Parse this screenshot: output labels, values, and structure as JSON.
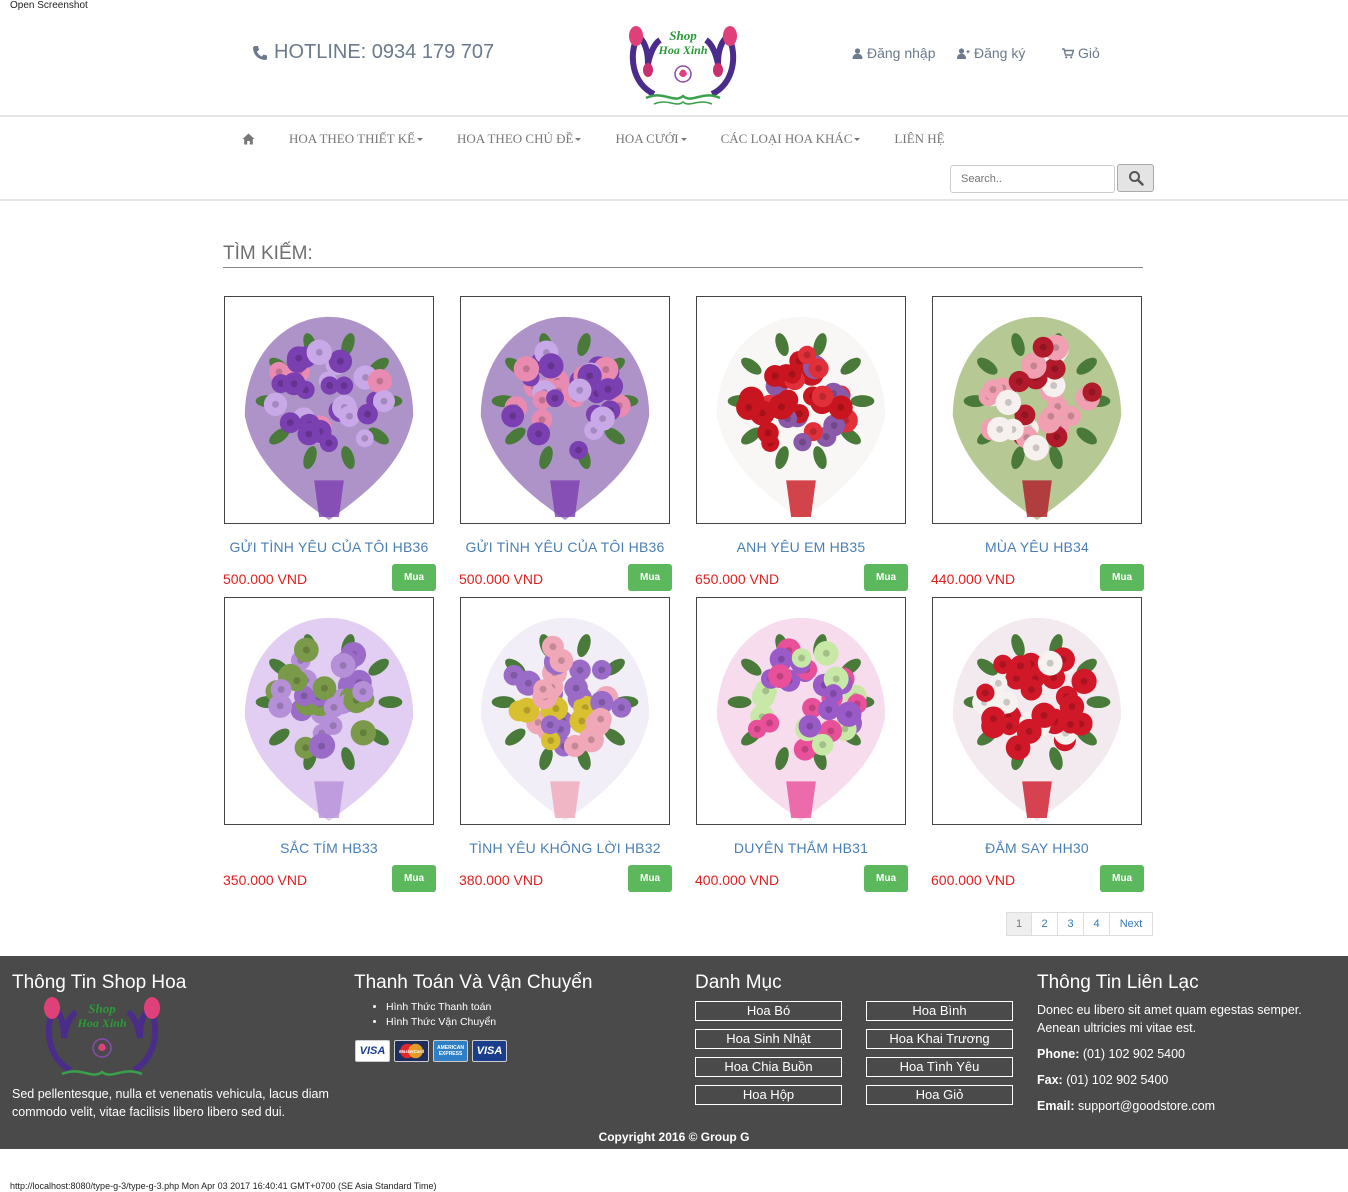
{
  "window": {
    "top_note": "Open Screenshot",
    "bottom_note": "http://localhost:8080/type-g-3/type-g-3.php Mon Apr 03 2017 16:40:41 GMT+0700 (SE Asia Standard Time)"
  },
  "header": {
    "hotline": "HOTLINE: 0934 179 707",
    "logo_text": [
      "Shop",
      "Hoa Xinh"
    ],
    "login": "Đăng nhập",
    "register": "Đăng ký",
    "cart": "Giỏ"
  },
  "nav": {
    "items": [
      "HOA THEO THIẾT KẾ",
      "HOA THEO CHỦ ĐỀ",
      "HOA CƯỚI",
      "CÁC LOẠI HOA KHÁC",
      "LIÊN HỆ"
    ],
    "search_placeholder": "Search.."
  },
  "main": {
    "title": "TÌM KIẾM:",
    "buy_label": "Mua",
    "products": [
      {
        "name": "GỬI TÌNH YÊU CỦA TÔI HB36",
        "price": "500.000 VND",
        "palette": [
          "#7a3fb0",
          "#e98bb0",
          "#c9a8e8",
          "#6a3a9a"
        ]
      },
      {
        "name": "GỬI TÌNH YÊU CỦA TÔI HB36",
        "price": "500.000 VND",
        "palette": [
          "#7a3fb0",
          "#e98bb0",
          "#c9a8e8",
          "#6a3a9a"
        ]
      },
      {
        "name": "ANH YÊU EM HB35",
        "price": "650.000 VND",
        "palette": [
          "#c8151f",
          "#e1303a",
          "#8a5aa8",
          "#f4f1ee"
        ]
      },
      {
        "name": "MÙA YÊU HB34",
        "price": "440.000 VND",
        "palette": [
          "#b01a2a",
          "#f0a0b0",
          "#f6f0ee",
          "#7a9a3a"
        ]
      },
      {
        "name": "SẮC TÍM HB33",
        "price": "350.000 VND",
        "palette": [
          "#b590d8",
          "#9a6cc8",
          "#7a9a4a",
          "#c9a5e8"
        ]
      },
      {
        "name": "TÌNH YÊU KHÔNG LỜI HB32",
        "price": "380.000 VND",
        "palette": [
          "#f0a8b8",
          "#d8c030",
          "#9a6cc8",
          "#e8e0f0"
        ]
      },
      {
        "name": "DUYÊN THẮM HB31",
        "price": "400.000 VND",
        "palette": [
          "#e8509a",
          "#c8e8a8",
          "#9a5ac8",
          "#f0c0e0"
        ]
      },
      {
        "name": "ĐẮM SAY HH30",
        "price": "600.000 VND",
        "palette": [
          "#d01828",
          "#f6f2f0",
          "#d01828",
          "#e8d8e0"
        ]
      }
    ],
    "pagination": [
      "1",
      "2",
      "3",
      "4",
      "Next"
    ]
  },
  "footer": {
    "col1_title": "Thông Tin Shop Hoa",
    "col1_desc": "Sed pellentesque, nulla et venenatis vehicula, lacus diam commodo velit, vitae facilisis libero libero sed dui.",
    "col2_title": "Thanh Toán Và Vận Chuyển",
    "col2_items": [
      "Hình Thức Thanh toán",
      "Hình Thức Vận Chuyển"
    ],
    "cards": [
      "VISA",
      "MasterCard",
      "AMERICAN EXPRESS",
      "VISA"
    ],
    "col3_title": "Danh Mục",
    "categories": [
      "Hoa Bó",
      "Hoa Bình",
      "Hoa Sinh Nhật",
      "Hoa Khai Trương",
      "Hoa Chia Buồn",
      "Hoa Tình Yêu",
      "Hoa Hộp",
      "Hoa Giỏ"
    ],
    "col4_title": "Thông Tin Liên Lạc",
    "col4_desc": "Donec eu libero sit amet quam egestas semper. Aenean ultricies mi vitae est.",
    "phone_label": "Phone:",
    "phone": "(01) 102 902 5400",
    "fax_label": "Fax:",
    "fax": "(01) 102 902 5400",
    "email_label": "Email:",
    "email": "support@goodstore.com",
    "copyright": "Copyright 2016 © Group G"
  }
}
